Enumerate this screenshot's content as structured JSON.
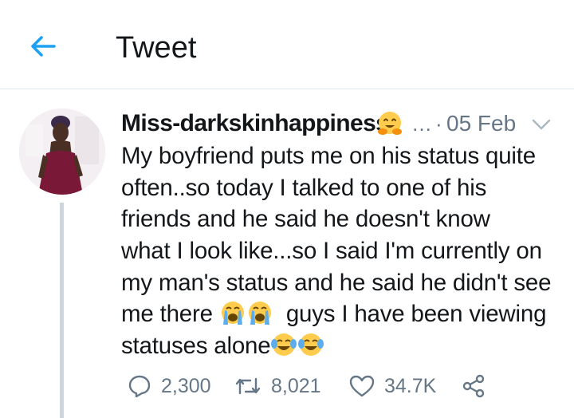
{
  "header": {
    "title": "Tweet",
    "back_icon": "arrow-left-icon"
  },
  "colors": {
    "accent": "#1da1f2",
    "secondary_text": "#657786",
    "divider": "#e1e8ed",
    "thread_line": "#ccd6dd"
  },
  "tweet": {
    "author_name": "Miss-darkskinhappiness",
    "name_emoji": "hugging-face-emoji",
    "handle_truncation": "…",
    "separator": "·",
    "date": "05 Feb",
    "menu_icon": "chevron-down-icon",
    "lines": [
      "My boyfriend puts me on his status quite",
      "often..so today I talked to one of his",
      "friends and he said he doesn't know",
      "what I look like...so I said I'm currently on",
      "my man's status and he said he didn't see"
    ],
    "line6_start": "me there",
    "line6_end": "guys I have been viewing",
    "line7": "statuses alone",
    "emojis": [
      "loudly-crying-face-emoji",
      "face-with-tears-of-joy-emoji"
    ]
  },
  "actions": {
    "reply_count": "2,300",
    "retweet_count": "8,021",
    "like_count": "34.7K",
    "reply_icon": "reply-icon",
    "retweet_icon": "retweet-icon",
    "like_icon": "heart-icon",
    "share_icon": "share-icon"
  }
}
